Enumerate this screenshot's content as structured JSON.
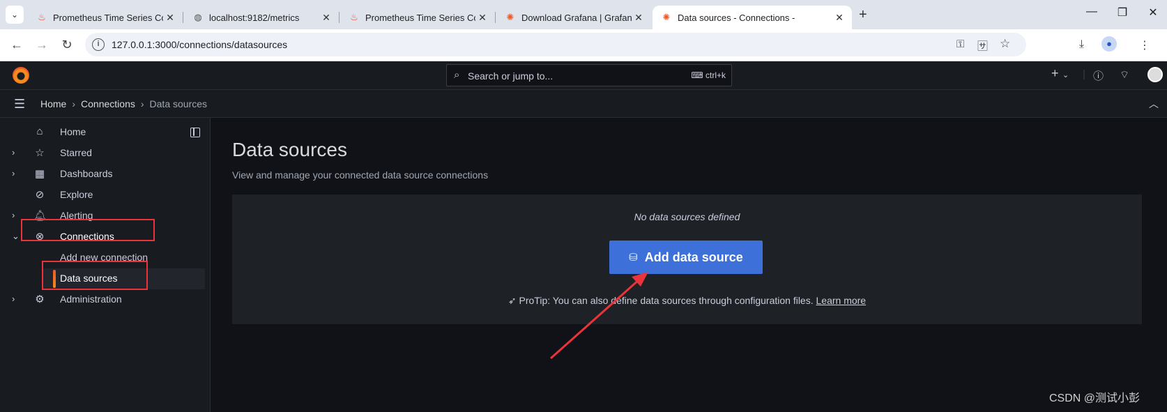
{
  "browser": {
    "tabs": [
      {
        "title": "Prometheus Time Series Colle",
        "icon": "prometheus-icon"
      },
      {
        "title": "localhost:9182/metrics",
        "icon": "globe-icon"
      },
      {
        "title": "Prometheus Time Series Colle",
        "icon": "prometheus-icon"
      },
      {
        "title": "Download Grafana | Grafana",
        "icon": "grafana-icon"
      },
      {
        "title": "Data sources - Connections -",
        "icon": "grafana-icon"
      }
    ],
    "url": "127.0.0.1:3000/connections/datasources"
  },
  "topbar": {
    "search_placeholder": "Search or jump to...",
    "shortcut": "ctrl+k"
  },
  "breadcrumb": [
    "Home",
    "Connections",
    "Data sources"
  ],
  "sidebar": {
    "items": [
      {
        "label": "Home"
      },
      {
        "label": "Starred"
      },
      {
        "label": "Dashboards"
      },
      {
        "label": "Explore"
      },
      {
        "label": "Alerting"
      },
      {
        "label": "Connections"
      },
      {
        "label": "Add new connection"
      },
      {
        "label": "Data sources"
      },
      {
        "label": "Administration"
      }
    ]
  },
  "main": {
    "title": "Data sources",
    "subtitle": "View and manage your connected data source connections",
    "empty_message": "No data sources defined",
    "add_button": "Add data source",
    "protip": "ProTip: You can also define data sources through configuration files.",
    "learn_more": "Learn more"
  },
  "watermark": "CSDN @测试小彭",
  "colors": {
    "accent": "#3d71d9",
    "highlight": "#e8343a",
    "brand": "#f05a28"
  }
}
